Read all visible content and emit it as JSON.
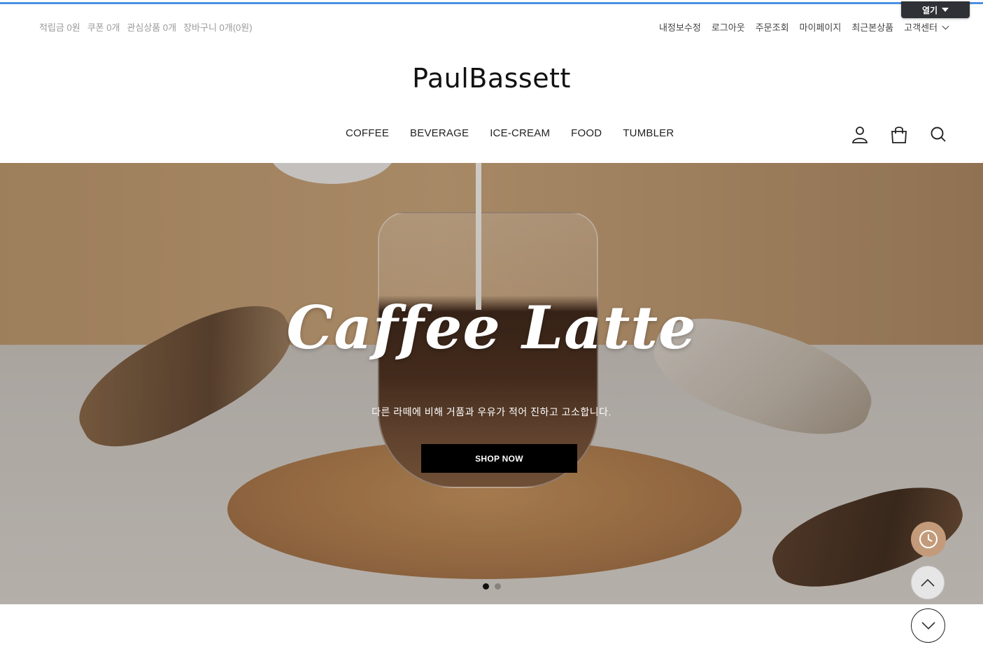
{
  "admin_tab": {
    "label": "열기",
    "icon": "caret-down-icon"
  },
  "utility_left": [
    "적립금 0원",
    "쿠폰 0개",
    "관심상품 0개",
    "장바구니 0개(0원)"
  ],
  "utility_right": {
    "links": [
      "내정보수정",
      "로그아웃",
      "주문조회",
      "마이페이지",
      "최근본상품"
    ],
    "customer_center": "고객센터"
  },
  "logo": "PaulBassett",
  "nav": [
    "COFFEE",
    "BEVERAGE",
    "ICE-CREAM",
    "FOOD",
    "TUMBLER"
  ],
  "header_icons": [
    "user-icon",
    "shopping-bag-icon",
    "search-icon"
  ],
  "hero": {
    "title": "Caffee Latte",
    "subtitle": "다른 라떼에 비해 거품과 우유가 적어 진하고 고소합니다.",
    "button": "SHOP NOW",
    "slide_count": 2,
    "active_slide": 1
  },
  "floating": [
    "recent-view-icon",
    "scroll-up-icon",
    "scroll-down-icon"
  ],
  "colors": {
    "accent_bar": "#4a90e2",
    "recent_button": "#c39b7a",
    "button_bg": "#000000"
  }
}
